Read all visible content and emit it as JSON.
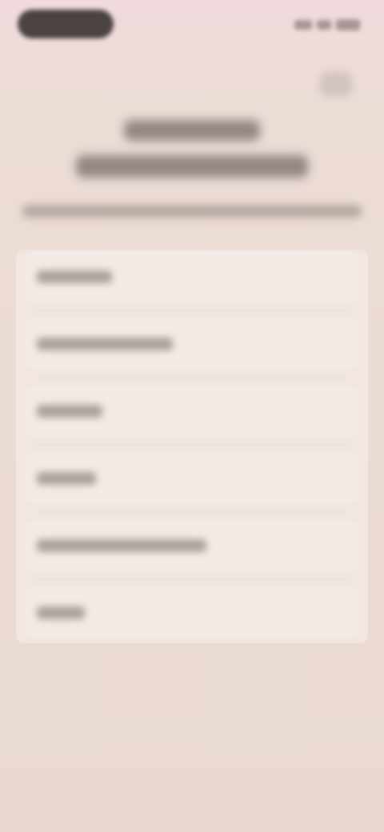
{
  "status_bar": {
    "time_pill": "",
    "icons": [
      "signal-icon",
      "wifi-icon",
      "battery-icon"
    ]
  },
  "header": {
    "close_icon": "close-icon",
    "title_line_1": "",
    "title_line_2": "",
    "subtitle": ""
  },
  "options": [
    {
      "label": ""
    },
    {
      "label": ""
    },
    {
      "label": ""
    },
    {
      "label": ""
    },
    {
      "label": ""
    },
    {
      "label": ""
    }
  ],
  "colors": {
    "background": "#ebdbd4",
    "card": "#f1e6e1",
    "text_dark": "#3a3230"
  }
}
